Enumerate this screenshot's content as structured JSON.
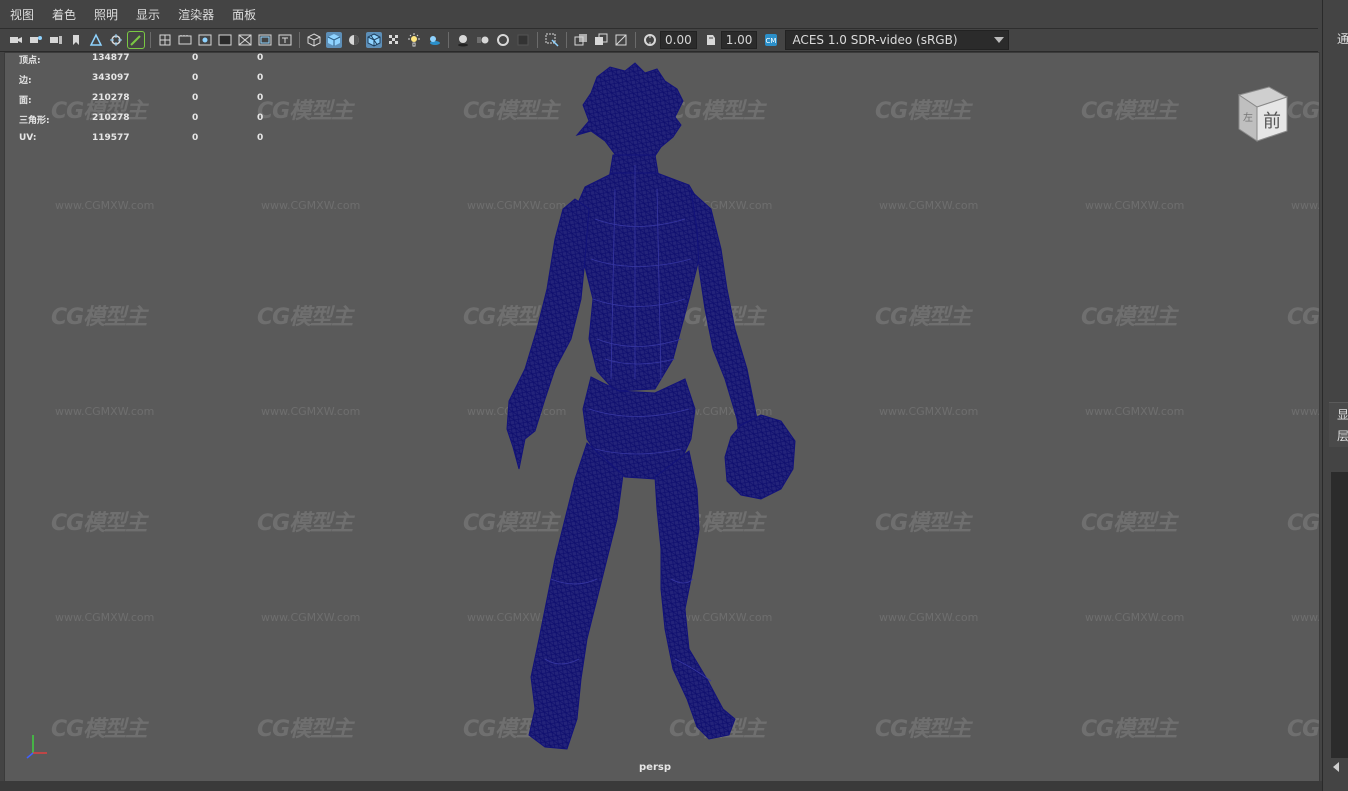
{
  "menubar": {
    "items": [
      "视图",
      "着色",
      "照明",
      "显示",
      "渲染器",
      "面板"
    ]
  },
  "toolbar": {
    "icons": [
      "camera-select-icon",
      "camera-attributes-icon",
      "bookmark-icon",
      "bookmark2-icon",
      "image-plane-icon",
      "2d-pan-icon",
      "grease-pencil-icon",
      "grid-icon",
      "film-gate-icon",
      "resolution-gate-icon",
      "gate-mask-icon",
      "field-chart-icon",
      "safe-action-icon",
      "safe-title-icon",
      "wireframe-icon",
      "smooth-shade-icon",
      "default-material-icon",
      "wireframe-on-shaded-icon",
      "textured-icon",
      "use-all-lights-icon",
      "shadows-icon",
      "screen-space-ao-icon",
      "motion-blur-icon",
      "multisample-aa-icon",
      "depth-of-field-icon",
      "isolate-select-icon",
      "xray-icon",
      "xray-joints-icon",
      "xray-components-icon",
      "backface-culling-icon",
      "exposure-icon",
      "gamma-icon",
      "color-management-icon"
    ],
    "exposure_value": "0.00",
    "gamma_value": "1.00",
    "color_space": "ACES 1.0 SDR-video (sRGB)"
  },
  "hud": {
    "rows": [
      {
        "label": "顶点:",
        "v1": "134877",
        "v2": "0",
        "v3": "0"
      },
      {
        "label": "边:",
        "v1": "343097",
        "v2": "0",
        "v3": "0"
      },
      {
        "label": "面:",
        "v1": "210278",
        "v2": "0",
        "v3": "0"
      },
      {
        "label": "三角形:",
        "v1": "210278",
        "v2": "0",
        "v3": "0"
      },
      {
        "label": "UV:",
        "v1": "119577",
        "v2": "0",
        "v3": "0"
      }
    ]
  },
  "viewport": {
    "camera_label": "persp",
    "viewcube_front": "前",
    "viewcube_left": "左",
    "watermark_logo": "CG模型主",
    "watermark_url": "www.CGMXW.com",
    "mesh_color": "#1a1a8c",
    "background_color": "#5a5a5a"
  },
  "right_panel": {
    "labels": [
      "通",
      "显",
      "层"
    ]
  }
}
